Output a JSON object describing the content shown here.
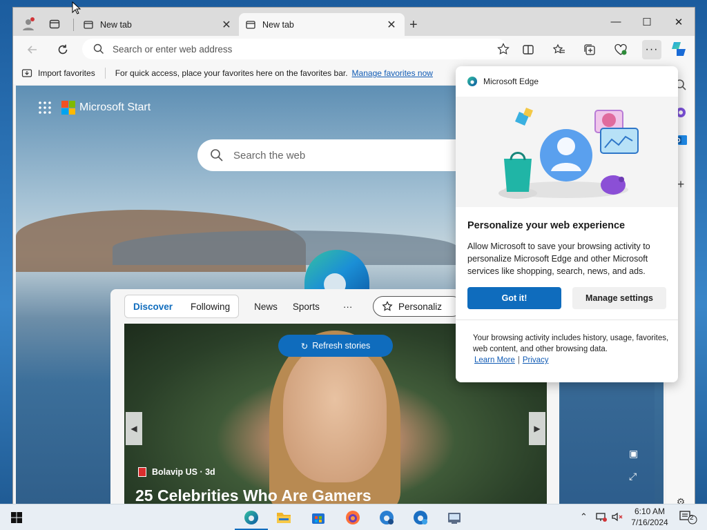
{
  "browser": {
    "tabs": [
      {
        "title": "New tab",
        "active": false
      },
      {
        "title": "New tab",
        "active": true
      }
    ],
    "address_placeholder": "Search or enter web address"
  },
  "favorites_bar": {
    "import_label": "Import favorites",
    "hint": "For quick access, place your favorites here on the favorites bar.",
    "manage_link": "Manage favorites now"
  },
  "newtab": {
    "brand": "Microsoft Start",
    "search_placeholder": "Search the web",
    "feed_tabs": [
      "Discover",
      "Following",
      "News",
      "Sports",
      "···"
    ],
    "personalize_label": "Personaliz",
    "refresh_label": "Refresh stories",
    "story_source": "Bolavip US · 3d",
    "story_headline": "25 Celebrities Who Are Gamers"
  },
  "popup": {
    "app_name": "Microsoft Edge",
    "title": "Personalize your web experience",
    "body": "Allow Microsoft to save your browsing activity to personalize Microsoft Edge and other Microsoft services like shopping, search, news, and ads.",
    "primary_button": "Got it!",
    "secondary_button": "Manage settings",
    "note": "Your browsing activity includes history, usage, favorites, web content, and other browsing data.",
    "link_learn_more": "Learn More",
    "link_separator": "|",
    "link_privacy": "Privacy"
  },
  "taskbar": {
    "time": "6:10 AM",
    "date": "7/16/2024",
    "notification_count": "2"
  },
  "colors": {
    "accent": "#0f6cbd",
    "taskbar": "#e8eef4"
  }
}
